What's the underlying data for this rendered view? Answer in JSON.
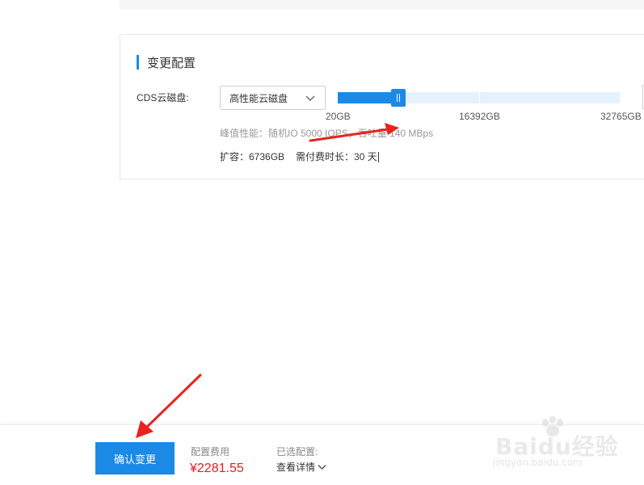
{
  "config_section": {
    "title": "变更配置",
    "disk_label": "CDS云磁盘:",
    "disk_type": "高性能云磁盘",
    "slider": {
      "min_label": "20GB",
      "mid_label": "16392GB",
      "max_label": "32765GB",
      "min_gb": 20,
      "max_gb": 32765,
      "value_gb": 6736
    },
    "performance": "峰值性能：随机IO 5000 IOPS，吞吐量 140 MBps",
    "expand_text": "扩容：6736GB",
    "duration_text": "需付费时长：30 天"
  },
  "footer": {
    "confirm_label": "确认变更",
    "fee_label": "配置费用",
    "fee_value": "¥2281.55",
    "selected_label": "已选配置:",
    "detail_link": "查看详情"
  },
  "watermark": {
    "logo": "Baidu经验",
    "url": "jingyan.baidu.com"
  },
  "colors": {
    "accent": "#1a8ae6",
    "price": "#e0201e",
    "annotation_arrow": "#e8231f"
  }
}
